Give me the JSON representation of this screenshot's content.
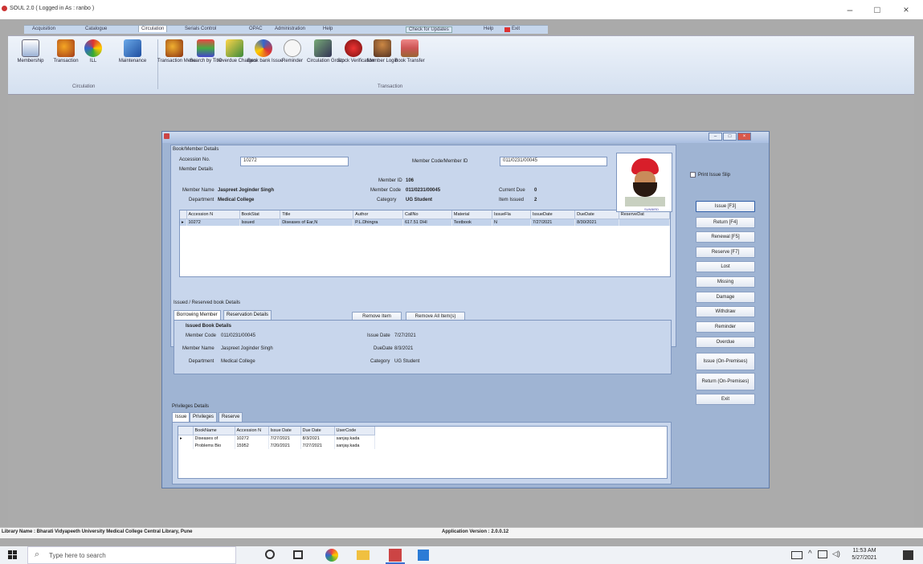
{
  "window": {
    "title": "SOUL 2.0 ( Logged in As : ranbo )",
    "controls": [
      "–",
      "□",
      "×"
    ]
  },
  "menu": {
    "items": [
      "Acquisition",
      "Catalogue",
      "Circulation",
      "Serials Control",
      "OPAC",
      "Administration",
      "Help",
      "Check for Updates",
      "Help",
      "Exit"
    ]
  },
  "ribbon": {
    "buttons": [
      {
        "label": "Membership",
        "icon": "id-card-icon"
      },
      {
        "label": "Transaction",
        "icon": "people-icon"
      },
      {
        "label": "ILL",
        "icon": "exchange-icon"
      },
      {
        "label": "Maintenance",
        "icon": "book-blue-icon"
      },
      {
        "label": "Transaction Menu",
        "icon": "people-menu-icon"
      },
      {
        "label": "Search by Title",
        "icon": "search-books-icon"
      },
      {
        "label": "Overdue Charges",
        "icon": "pencil-charges-icon"
      },
      {
        "label": "Book bank Issue",
        "icon": "bookbank-icon"
      },
      {
        "label": "Reminder",
        "icon": "clock-icon"
      },
      {
        "label": "Circulation Group",
        "icon": "group-icon"
      },
      {
        "label": "Stock Verification",
        "icon": "verification-icon"
      },
      {
        "label": "Member Login",
        "icon": "member-icon"
      },
      {
        "label": "Book Transfer",
        "icon": "transfer-icon"
      }
    ],
    "groups": [
      "Circulation",
      "Transaction"
    ]
  },
  "dialog": {
    "section_book": "Book/Member Details",
    "accession_label": "Accession No.",
    "accession_value": "10272",
    "member_code_label": "Member Code/Member ID",
    "member_code_value": "011/0231/00045",
    "member_details": "Member Details",
    "member_id_label": "Member ID",
    "member_id_value": "106",
    "member_name_label": "Member Name",
    "member_name_value": "Jaspreet Joginder Singh",
    "member_code2_label": "Member Code",
    "member_code2_value": "011/0231/00045",
    "current_due_label": "Current Due",
    "current_due_value": "0",
    "department_label": "Department",
    "department_value": "Medical College",
    "category_label": "Category",
    "category_value": "UG Student",
    "items_issued_label": "Item Issued",
    "items_issued_value": "2",
    "photo_caption": "SUNBIRD",
    "print_slip": "Print Issue Slip",
    "grid_headers": [
      "Accession N",
      "BookStat",
      "Title",
      "Author",
      "CallNo",
      "Material",
      "IssueFla",
      "IssueDate",
      "DueDate",
      "ReserveDat"
    ],
    "grid_rows": [
      [
        "10272",
        "Issued",
        "Diseases of Ear,N",
        "P.L.Dhingra",
        "617.51 DHI",
        "Textbook",
        "N",
        "7/27/2021",
        "8/30/2021",
        ""
      ]
    ],
    "remove_item": "Remove Item",
    "remove_all": "Remove All Item(s)",
    "issued_section": "Issued / Reserved book Details",
    "tabs": [
      "Borrowing Member",
      "Reservation Details"
    ],
    "issued_title": "Issued Book Details",
    "i_member_code_label": "Member Code",
    "i_member_code_value": "011/0231/00045",
    "i_member_name_label": "Member Name",
    "i_member_name_value": "Jaspreet Joginder Singh",
    "i_department_label": "Department",
    "i_department_value": "Medical College",
    "i_issue_date_label": "Issue Date",
    "i_issue_date_value": "7/27/2021",
    "i_due_date_label": "DueDate",
    "i_due_date_value": "8/3/2021",
    "i_category_label": "Category",
    "i_category_value": "UG Student",
    "priv_section": "Privileges Details",
    "priv_tabs": [
      "Issue",
      "Privileges",
      "Reserve"
    ],
    "priv_headers": [
      "BookName",
      "Accession N",
      "Issue Date",
      "Due Date",
      "UserCode"
    ],
    "priv_rows": [
      [
        "Diseases of",
        "10272",
        "7/27/2021",
        "8/3/2021",
        "sanjay.kada"
      ],
      [
        "Problems Bio",
        "15952",
        "7/20/2021",
        "7/27/2021",
        "sanjay.kada"
      ]
    ],
    "side_buttons": [
      "Issue [F3]",
      "Return [F4]",
      "Renewal [F5]",
      "Reserve [F7]",
      "Lost",
      "Missing",
      "Damage",
      "Withdraw",
      "Reminder",
      "Overdue",
      "Issue (On-Premises)",
      "Return (On-Premises)",
      "Exit"
    ]
  },
  "status": {
    "library": "Library Name : Bharati Vidyapeeth University Medical College Central Library, Pune",
    "version": "Application Version : 2.0.0.12"
  },
  "taskbar": {
    "search_placeholder": "Type here to search",
    "time": "11:53 AM",
    "date": "5/27/2021"
  }
}
